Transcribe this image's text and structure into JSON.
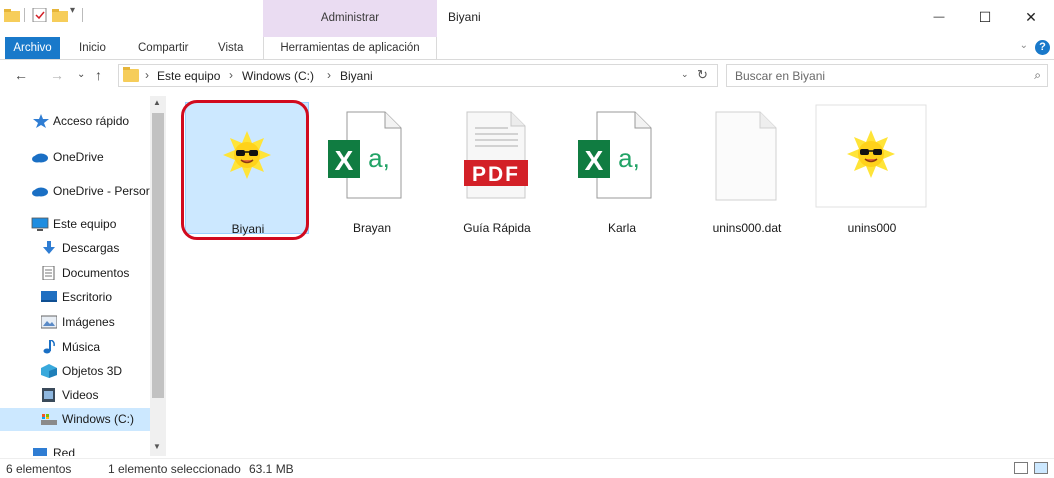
{
  "titlebar": {
    "context_tab_label": "Administrar",
    "window_title": "Biyani",
    "minimize_glyph": "—",
    "maximize_glyph": "☐",
    "close_glyph": "✕"
  },
  "ribbon": {
    "tabs": [
      "Archivo",
      "Inicio",
      "Compartir",
      "Vista",
      "Herramientas de aplicación"
    ],
    "help_glyph": "?",
    "chevron_glyph": "⌄"
  },
  "addressbar": {
    "back_glyph": "←",
    "forward_glyph": "→",
    "recent_glyph": "⌄",
    "up_glyph": "↑",
    "separator": "›",
    "crumbs": [
      "Este equipo",
      "Windows (C:)",
      "Biyani"
    ],
    "dropdown_glyph": "⌄",
    "refresh_glyph": "↻",
    "search_placeholder": "Buscar en Biyani",
    "search_glyph": "⌕"
  },
  "sidebar": {
    "items": [
      {
        "label": "Acceso rápido",
        "icon": "star-icon"
      },
      {
        "label": "OneDrive",
        "icon": "cloud-icon"
      },
      {
        "label": "OneDrive - Persor",
        "icon": "cloud-icon"
      },
      {
        "label": "Este equipo",
        "icon": "computer-icon"
      },
      {
        "label": "Descargas",
        "icon": "download-icon"
      },
      {
        "label": "Documentos",
        "icon": "document-icon"
      },
      {
        "label": "Escritorio",
        "icon": "desktop-icon"
      },
      {
        "label": "Imágenes",
        "icon": "pictures-icon"
      },
      {
        "label": "Música",
        "icon": "music-icon"
      },
      {
        "label": "Objetos 3D",
        "icon": "3d-objects-icon"
      },
      {
        "label": "Videos",
        "icon": "video-icon"
      },
      {
        "label": "Windows (C:)",
        "icon": "drive-icon",
        "selected": true
      },
      {
        "label": "Red",
        "icon": "network-icon"
      }
    ],
    "scroll_up_glyph": "▲",
    "scroll_down_glyph": "▼"
  },
  "files": [
    {
      "name": "Biyani",
      "icon": "sun-sunglasses-icon",
      "selected": true
    },
    {
      "name": "Brayan",
      "icon": "excel-icon"
    },
    {
      "name": "Guía Rápida",
      "icon": "pdf-icon"
    },
    {
      "name": "Karla",
      "icon": "excel-icon"
    },
    {
      "name": "unins000.dat",
      "icon": "blank-file-icon"
    },
    {
      "name": "unins000",
      "icon": "sun-sunglasses-icon"
    }
  ],
  "icon_text": {
    "excel_letter": "X",
    "excel_suffix": "a,",
    "pdf_label": "PDF"
  },
  "statusbar": {
    "item_count": "6 elementos",
    "selection": "1 elemento seleccionado",
    "size": "63.1 MB"
  },
  "colors": {
    "accent": "#1979ca",
    "context_band": "#eadcf2",
    "selection": "#cce8ff",
    "highlight_ring": "#d10a1e",
    "excel_green": "#107c41",
    "pdf_red": "#d32027"
  }
}
